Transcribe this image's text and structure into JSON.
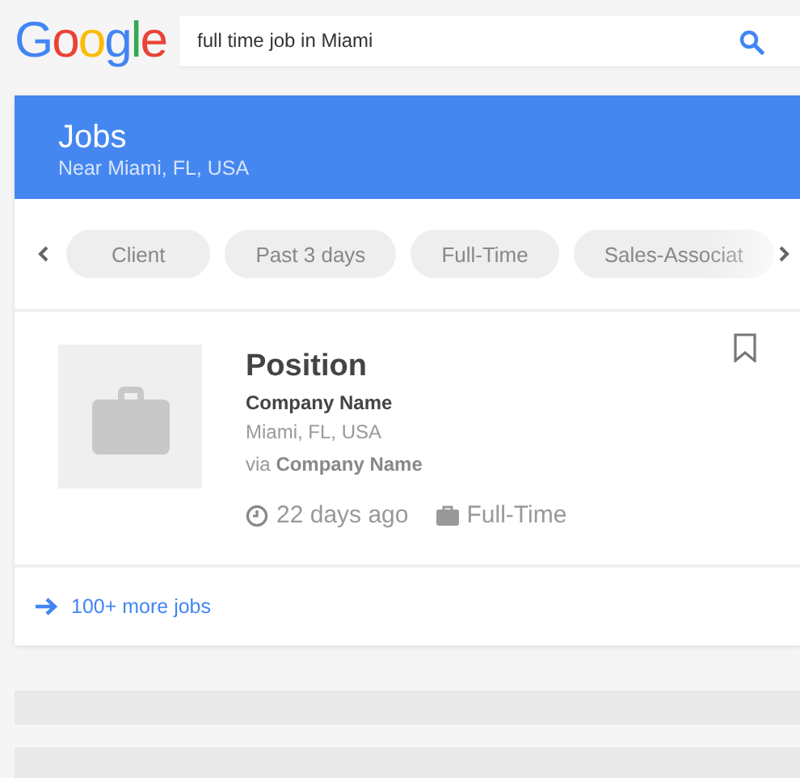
{
  "logo": [
    {
      "letter": "G",
      "color": "#4285f4"
    },
    {
      "letter": "o",
      "color": "#ea4335"
    },
    {
      "letter": "o",
      "color": "#fbbc05"
    },
    {
      "letter": "g",
      "color": "#4285f4"
    },
    {
      "letter": "l",
      "color": "#34a853"
    },
    {
      "letter": "e",
      "color": "#ea4335"
    }
  ],
  "search": {
    "value": "full time job in Miami"
  },
  "panel": {
    "title": "Jobs",
    "subtitle": "Near Miami, FL, USA"
  },
  "chips": [
    {
      "label": "Client"
    },
    {
      "label": "Past 3 days"
    },
    {
      "label": "Full-Time"
    },
    {
      "label": "Sales-Associat"
    }
  ],
  "job": {
    "title": "Position",
    "company": "Company Name",
    "location": "Miami, FL, USA",
    "via": "via **Company Name**",
    "posted": "22 days ago",
    "type": "Full-Time"
  },
  "more_link": "100+ more jobs"
}
